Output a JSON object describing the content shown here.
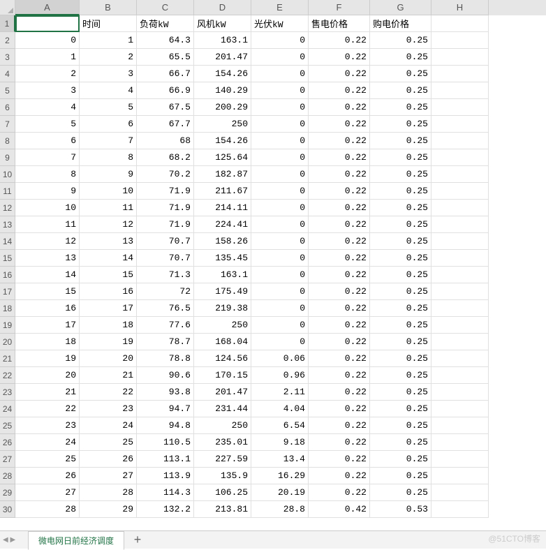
{
  "columns": [
    "A",
    "B",
    "C",
    "D",
    "E",
    "F",
    "G",
    "H"
  ],
  "row_numbers": [
    1,
    2,
    3,
    4,
    5,
    6,
    7,
    8,
    9,
    10,
    11,
    12,
    13,
    14,
    15,
    16,
    17,
    18,
    19,
    20,
    21,
    22,
    23,
    24,
    25,
    26,
    27,
    28,
    29,
    30
  ],
  "headers": {
    "A": "",
    "B": "时间",
    "C": "负荷kW",
    "D": "风机kW",
    "E": "光伏kW",
    "F": "售电价格",
    "G": "购电价格"
  },
  "rows": [
    {
      "A": "0",
      "B": "1",
      "C": "64.3",
      "D": "163.1",
      "E": "0",
      "F": "0.22",
      "G": "0.25"
    },
    {
      "A": "1",
      "B": "2",
      "C": "65.5",
      "D": "201.47",
      "E": "0",
      "F": "0.22",
      "G": "0.25"
    },
    {
      "A": "2",
      "B": "3",
      "C": "66.7",
      "D": "154.26",
      "E": "0",
      "F": "0.22",
      "G": "0.25"
    },
    {
      "A": "3",
      "B": "4",
      "C": "66.9",
      "D": "140.29",
      "E": "0",
      "F": "0.22",
      "G": "0.25"
    },
    {
      "A": "4",
      "B": "5",
      "C": "67.5",
      "D": "200.29",
      "E": "0",
      "F": "0.22",
      "G": "0.25"
    },
    {
      "A": "5",
      "B": "6",
      "C": "67.7",
      "D": "250",
      "E": "0",
      "F": "0.22",
      "G": "0.25"
    },
    {
      "A": "6",
      "B": "7",
      "C": "68",
      "D": "154.26",
      "E": "0",
      "F": "0.22",
      "G": "0.25"
    },
    {
      "A": "7",
      "B": "8",
      "C": "68.2",
      "D": "125.64",
      "E": "0",
      "F": "0.22",
      "G": "0.25"
    },
    {
      "A": "8",
      "B": "9",
      "C": "70.2",
      "D": "182.87",
      "E": "0",
      "F": "0.22",
      "G": "0.25"
    },
    {
      "A": "9",
      "B": "10",
      "C": "71.9",
      "D": "211.67",
      "E": "0",
      "F": "0.22",
      "G": "0.25"
    },
    {
      "A": "10",
      "B": "11",
      "C": "71.9",
      "D": "214.11",
      "E": "0",
      "F": "0.22",
      "G": "0.25"
    },
    {
      "A": "11",
      "B": "12",
      "C": "71.9",
      "D": "224.41",
      "E": "0",
      "F": "0.22",
      "G": "0.25"
    },
    {
      "A": "12",
      "B": "13",
      "C": "70.7",
      "D": "158.26",
      "E": "0",
      "F": "0.22",
      "G": "0.25"
    },
    {
      "A": "13",
      "B": "14",
      "C": "70.7",
      "D": "135.45",
      "E": "0",
      "F": "0.22",
      "G": "0.25"
    },
    {
      "A": "14",
      "B": "15",
      "C": "71.3",
      "D": "163.1",
      "E": "0",
      "F": "0.22",
      "G": "0.25"
    },
    {
      "A": "15",
      "B": "16",
      "C": "72",
      "D": "175.49",
      "E": "0",
      "F": "0.22",
      "G": "0.25"
    },
    {
      "A": "16",
      "B": "17",
      "C": "76.5",
      "D": "219.38",
      "E": "0",
      "F": "0.22",
      "G": "0.25"
    },
    {
      "A": "17",
      "B": "18",
      "C": "77.6",
      "D": "250",
      "E": "0",
      "F": "0.22",
      "G": "0.25"
    },
    {
      "A": "18",
      "B": "19",
      "C": "78.7",
      "D": "168.04",
      "E": "0",
      "F": "0.22",
      "G": "0.25"
    },
    {
      "A": "19",
      "B": "20",
      "C": "78.8",
      "D": "124.56",
      "E": "0.06",
      "F": "0.22",
      "G": "0.25"
    },
    {
      "A": "20",
      "B": "21",
      "C": "90.6",
      "D": "170.15",
      "E": "0.96",
      "F": "0.22",
      "G": "0.25"
    },
    {
      "A": "21",
      "B": "22",
      "C": "93.8",
      "D": "201.47",
      "E": "2.11",
      "F": "0.22",
      "G": "0.25"
    },
    {
      "A": "22",
      "B": "23",
      "C": "94.7",
      "D": "231.44",
      "E": "4.04",
      "F": "0.22",
      "G": "0.25"
    },
    {
      "A": "23",
      "B": "24",
      "C": "94.8",
      "D": "250",
      "E": "6.54",
      "F": "0.22",
      "G": "0.25"
    },
    {
      "A": "24",
      "B": "25",
      "C": "110.5",
      "D": "235.01",
      "E": "9.18",
      "F": "0.22",
      "G": "0.25"
    },
    {
      "A": "25",
      "B": "26",
      "C": "113.1",
      "D": "227.59",
      "E": "13.4",
      "F": "0.22",
      "G": "0.25"
    },
    {
      "A": "26",
      "B": "27",
      "C": "113.9",
      "D": "135.9",
      "E": "16.29",
      "F": "0.22",
      "G": "0.25"
    },
    {
      "A": "27",
      "B": "28",
      "C": "114.3",
      "D": "106.25",
      "E": "20.19",
      "F": "0.22",
      "G": "0.25"
    },
    {
      "A": "28",
      "B": "29",
      "C": "132.2",
      "D": "213.81",
      "E": "28.8",
      "F": "0.42",
      "G": "0.53"
    }
  ],
  "sheet": {
    "name": "微电网日前经济调度",
    "add_label": "+"
  },
  "watermark": "@51CTO博客",
  "active_cell": "A1"
}
